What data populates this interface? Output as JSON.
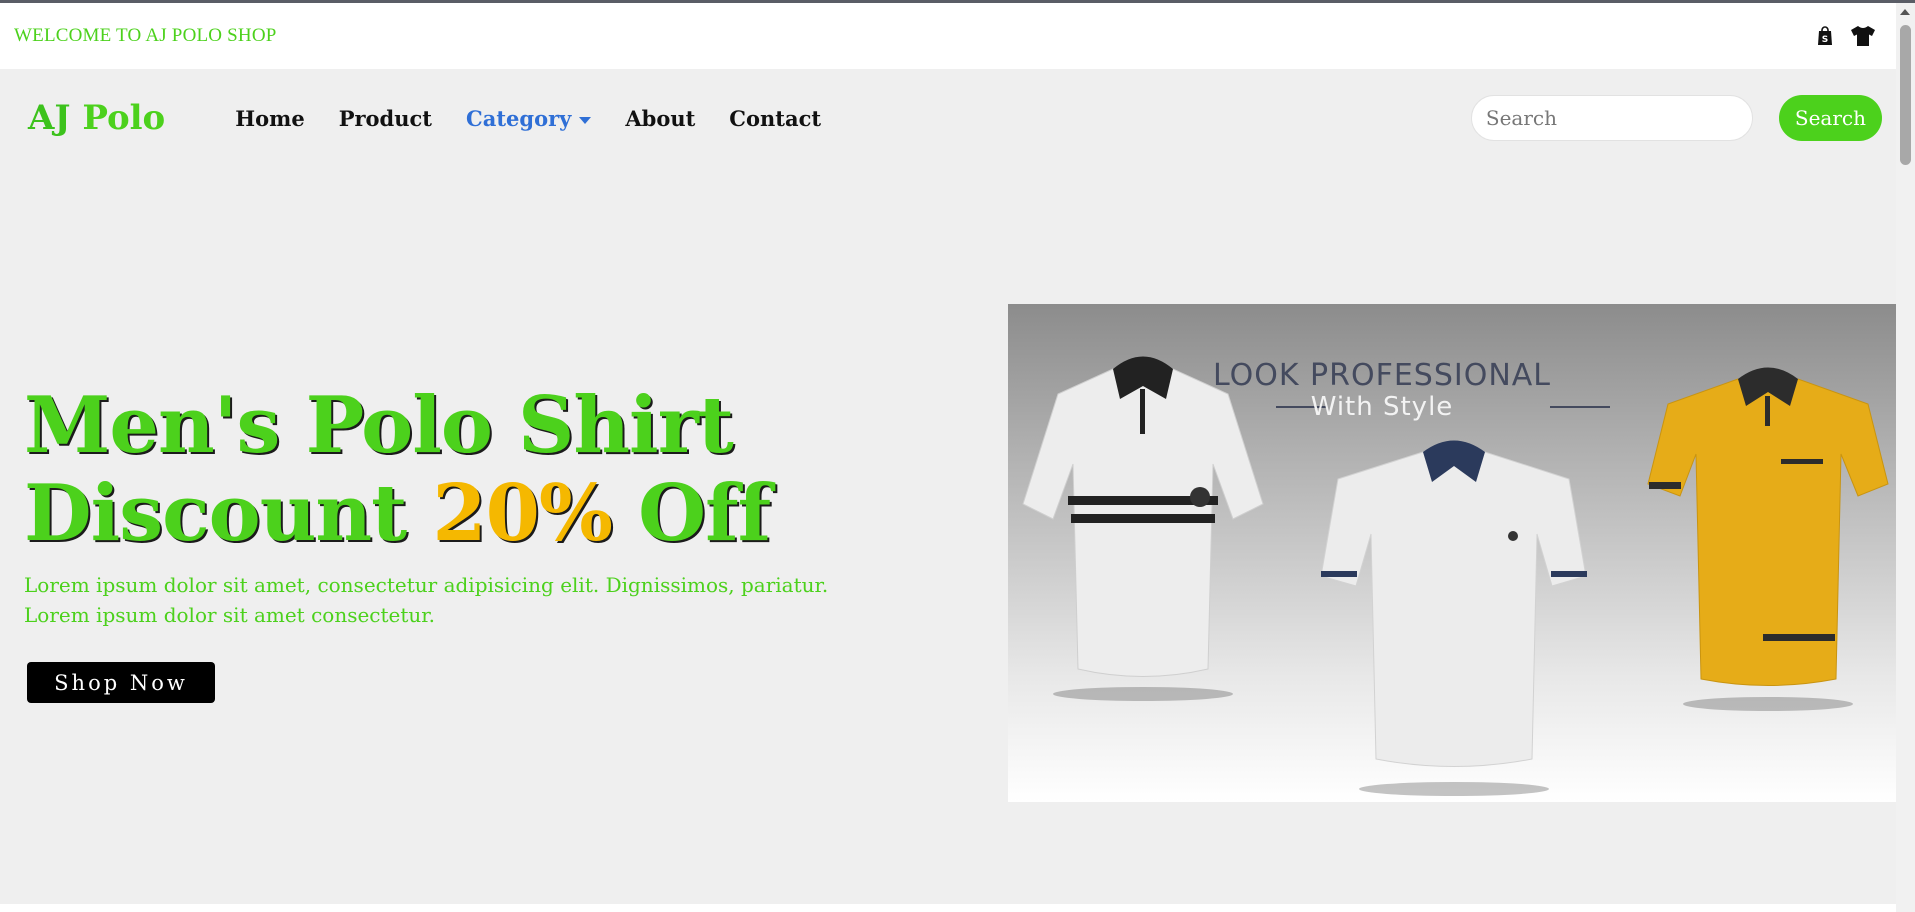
{
  "topbar": {
    "welcome": "WELCOME TO AJ POLO SHOP",
    "icons": [
      "shopping-bag-icon",
      "tshirt-icon"
    ]
  },
  "navbar": {
    "brand_aj": "AJ",
    "brand_polo": "Polo",
    "links": [
      {
        "label": "Home"
      },
      {
        "label": "Product"
      },
      {
        "label": "Category"
      },
      {
        "label": "About"
      },
      {
        "label": "Contact"
      }
    ],
    "search": {
      "placeholder": "Search",
      "button": "Search"
    }
  },
  "hero": {
    "headline_line1": "Men's Polo Shirt",
    "headline_line2_prefix": "Discount ",
    "headline_accent": "20%",
    "headline_line2_suffix": " Off",
    "subtext_line1": "Lorem ipsum dolor sit amet, consectetur adipisicing elit. Dignissimos, pariatur.",
    "subtext_line2": "Lorem ipsum dolor sit amet consectetur.",
    "cta": "Shop Now",
    "image_text_1": "LOOK PROFESSIONAL",
    "image_text_2": "With Style"
  },
  "colors": {
    "brand_green": "#4cd11c",
    "accent_yellow": "#f5b800",
    "active_link": "#2f6fd6"
  }
}
